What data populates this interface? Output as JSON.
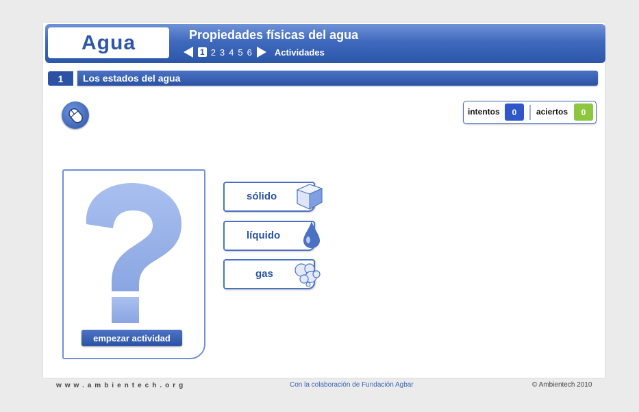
{
  "header": {
    "logo": "Agua",
    "title": "Propiedades físicas del agua",
    "pages": [
      "1",
      "2",
      "3",
      "4",
      "5",
      "6"
    ],
    "current_page": "1",
    "activities_label": "Actividades"
  },
  "section": {
    "number": "1",
    "title": "Los estados del agua"
  },
  "score": {
    "attempts_label": "intentos",
    "attempts_value": "0",
    "hits_label": "aciertos",
    "hits_value": "0",
    "attempts_color": "#2f57c9",
    "hits_color": "#8dc63f"
  },
  "card": {
    "start_button": "empezar actividad"
  },
  "options": [
    {
      "label": "sólido",
      "icon": "ice-cube-icon"
    },
    {
      "label": "líquido",
      "icon": "water-drop-icon"
    },
    {
      "label": "gas",
      "icon": "cloud-icon"
    }
  ],
  "footer": {
    "website": "www.ambientech.org",
    "collaboration": "Con la colaboración de Fundación Agbar",
    "copyright": "© Ambientech  2010"
  },
  "colors": {
    "brand_blue": "#2b52a4",
    "light_blue": "#93aee8"
  }
}
